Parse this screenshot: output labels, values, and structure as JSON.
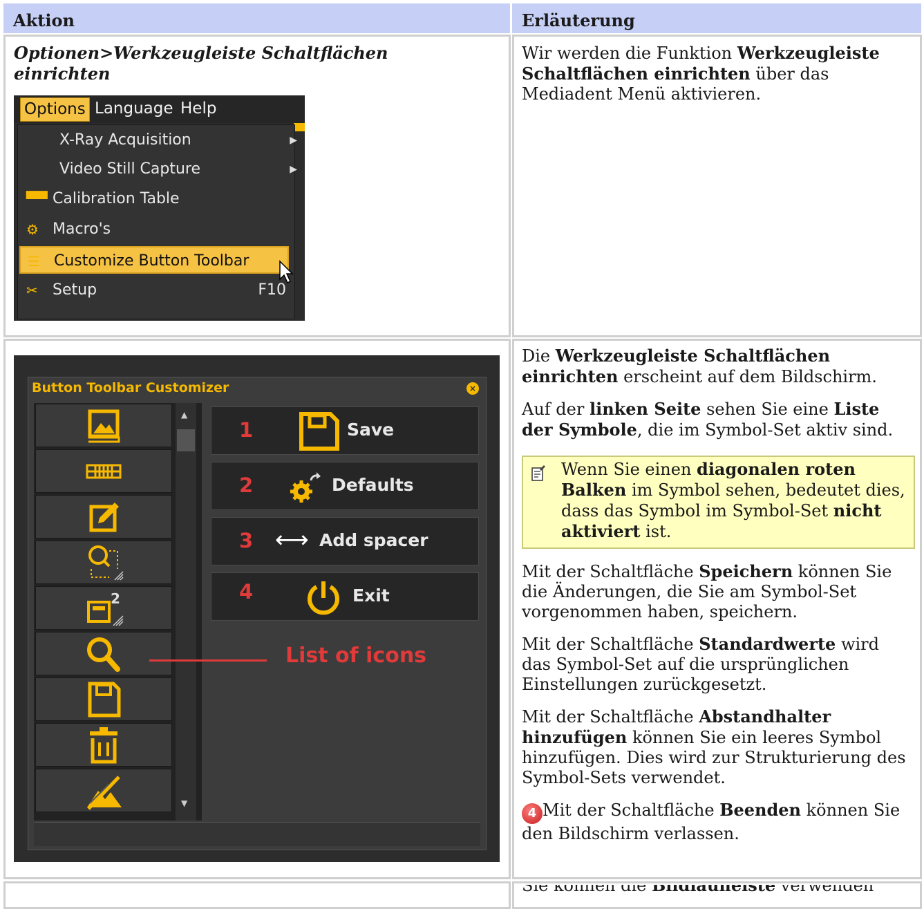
{
  "header": {
    "col1": "Aktion",
    "col2": "Erläuterung"
  },
  "row1": {
    "action_title": "Optionen>Werkzeugleiste Schaltflächen einrichten",
    "menu": {
      "bar": [
        "Options",
        "Language",
        "Help"
      ],
      "items": [
        {
          "label": "X-Ray Acquisition",
          "submenu": true
        },
        {
          "label": "Video Still Capture",
          "submenu": true
        },
        {
          "label": "Calibration Table",
          "icon": "ruler-icon"
        },
        {
          "label": "Macro's",
          "icon": "macro-icon"
        },
        {
          "label": "Customize Button Toolbar",
          "icon": "toolbar-icon",
          "selected": true
        },
        {
          "label": "Setup",
          "icon": "tools-icon",
          "shortcut": "F10"
        }
      ]
    },
    "expl": {
      "p1_pre": "Wir werden die Funktion ",
      "p1_b": "Werkzeugleiste Schaltflächen einrichten",
      "p1_post": " über das Mediadent Menü aktivieren."
    }
  },
  "row2": {
    "customizer": {
      "title": "Button Toolbar Customizer",
      "buttons": [
        {
          "num": "1",
          "label": "Save"
        },
        {
          "num": "2",
          "label": "Defaults"
        },
        {
          "num": "3",
          "label": "Add spacer"
        },
        {
          "num": "4",
          "label": "Exit"
        }
      ],
      "list_label": "List of icons"
    },
    "expl": {
      "p1_pre": "Die ",
      "p1_b": "Werkzeugleiste Schaltflächen einrichten",
      "p1_post": " erscheint auf dem Bildschirm.",
      "p2_a": "Auf der ",
      "p2_b1": "linken Seite",
      "p2_c": " sehen Sie eine ",
      "p2_b2": "Liste der Symbole",
      "p2_d": ", die im Symbol-Set aktiv sind.",
      "note_a": "Wenn Sie einen ",
      "note_b1": "diagonalen roten Balken",
      "note_c": " im Symbol sehen, bedeutet dies, dass das Symbol im Symbol-Set ",
      "note_b2": "nicht aktiviert",
      "note_d": " ist.",
      "p3_a": "Mit der Schaltfläche ",
      "p3_b": "Speichern",
      "p3_c": " können Sie die Änderungen, die Sie am Symbol-Set vorgenommen haben, speichern.",
      "p4_a": "Mit der Schaltfläche ",
      "p4_b": "Standardwerte",
      "p4_c": " wird das Symbol-Set auf die ursprünglichen Einstellungen zurückgesetzt.",
      "p5_a": "Mit der Schaltfläche ",
      "p5_b": "Abstandhalter hinzufügen",
      "p5_c": " können Sie ein leeres Symbol hinzufügen. Dies wird zur Strukturierung des Symbol-Sets verwendet.",
      "badge": "4",
      "p6_a": "Mit der Schaltfläche ",
      "p6_b": "Beenden",
      "p6_c": " können Sie den Bildschirm verlassen."
    }
  },
  "row3": {
    "partial_text_pre": "Sie können die ",
    "partial_text_b": "Bildlaufleiste",
    "partial_text_post": " verwenden"
  }
}
